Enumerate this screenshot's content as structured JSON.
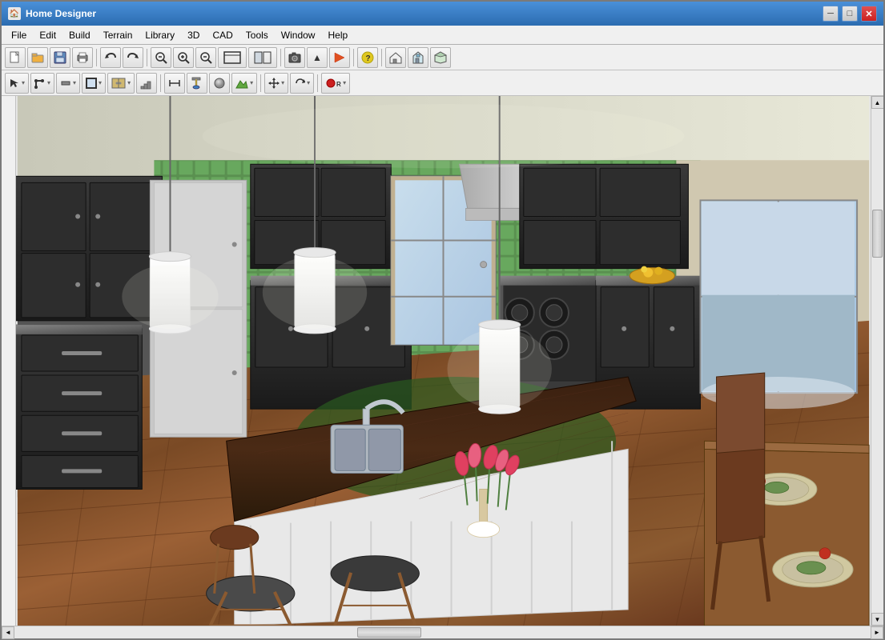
{
  "window": {
    "title": "Home Designer",
    "icon": "🏠"
  },
  "titlebar": {
    "controls": {
      "minimize": "─",
      "maximize": "□",
      "close": "✕"
    }
  },
  "menubar": {
    "items": [
      "File",
      "Edit",
      "Build",
      "Terrain",
      "Library",
      "3D",
      "CAD",
      "Tools",
      "Window",
      "Help"
    ]
  },
  "toolbar1": {
    "buttons": [
      {
        "name": "new",
        "icon": "📄"
      },
      {
        "name": "open",
        "icon": "📂"
      },
      {
        "name": "save",
        "icon": "💾"
      },
      {
        "name": "print",
        "icon": "🖨"
      },
      {
        "name": "undo",
        "icon": "↩"
      },
      {
        "name": "redo",
        "icon": "↪"
      },
      {
        "name": "zoom-out-small",
        "icon": "🔍"
      },
      {
        "name": "zoom-in",
        "icon": "⊕"
      },
      {
        "name": "zoom-out",
        "icon": "⊖"
      },
      {
        "name": "fit-window",
        "icon": "⊞"
      },
      {
        "name": "view-toggle",
        "icon": "⊟"
      },
      {
        "name": "camera",
        "icon": "📷"
      },
      {
        "name": "help",
        "icon": "?"
      },
      {
        "name": "house1",
        "icon": "🏠"
      },
      {
        "name": "house2",
        "icon": "🏡"
      },
      {
        "name": "house3",
        "icon": "🏘"
      }
    ]
  },
  "toolbar2": {
    "buttons": [
      {
        "name": "select",
        "icon": "↖"
      },
      {
        "name": "polyline",
        "icon": "∟"
      },
      {
        "name": "wall",
        "icon": "═"
      },
      {
        "name": "room",
        "icon": "▦"
      },
      {
        "name": "cabinet",
        "icon": "▤"
      },
      {
        "name": "stairs",
        "icon": "▥"
      },
      {
        "name": "dimension",
        "icon": "↔"
      },
      {
        "name": "paint",
        "icon": "🖌"
      },
      {
        "name": "material",
        "icon": "⊛"
      },
      {
        "name": "terrain",
        "icon": "⛰"
      },
      {
        "name": "move",
        "icon": "✛"
      },
      {
        "name": "rotate",
        "icon": "↻"
      },
      {
        "name": "record",
        "icon": "⏺"
      }
    ]
  },
  "kitchen": {
    "description": "3D kitchen interior rendering with dark cabinets, green tile backsplash, wood floor, island with sink"
  },
  "scrollbars": {
    "up_arrow": "▲",
    "down_arrow": "▼",
    "left_arrow": "◄",
    "right_arrow": "►"
  }
}
